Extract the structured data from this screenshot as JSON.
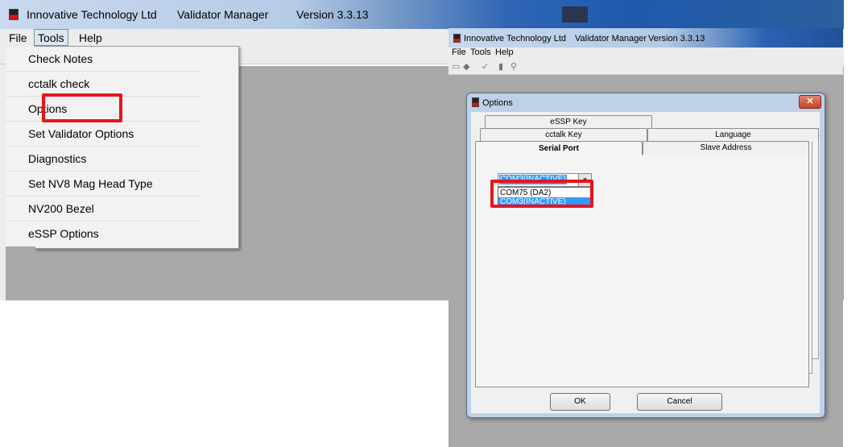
{
  "left_window": {
    "title": {
      "company": "Innovative Technology Ltd",
      "app": "Validator Manager",
      "version": "Version 3.3.13"
    },
    "menu": {
      "file": "File",
      "tools": "Tools",
      "help": "Help"
    },
    "tools_menu_items": [
      "Check Notes",
      "cctalk check",
      "Options",
      "Set Validator Options",
      "Diagnostics",
      "Set NV8 Mag Head Type",
      "NV200 Bezel",
      "eSSP Options"
    ]
  },
  "right_window": {
    "title": {
      "company": "Innovative Technology Ltd",
      "app": "Validator Manager",
      "version": "Version 3.3.13"
    },
    "menu": {
      "file": "File",
      "tools": "Tools",
      "help": "Help"
    },
    "options_dialog": {
      "title": "Options",
      "close_label": "✕",
      "tabs": {
        "essp_key": "eSSP Key",
        "cctalk_key": "cctalk Key",
        "language": "Language",
        "serial_port": "Serial Port",
        "slave_address": "Slave Address"
      },
      "com_port": {
        "selected": "COM3(INACTIVE)",
        "options": [
          "COM75 (DA2)",
          "COM3(INACTIVE)"
        ]
      },
      "buttons": {
        "ok": "OK",
        "cancel": "Cancel"
      }
    }
  },
  "colors": {
    "highlight_box": "#e8141b",
    "selection": "#3399ff",
    "client_area": "#a9a9a9"
  }
}
